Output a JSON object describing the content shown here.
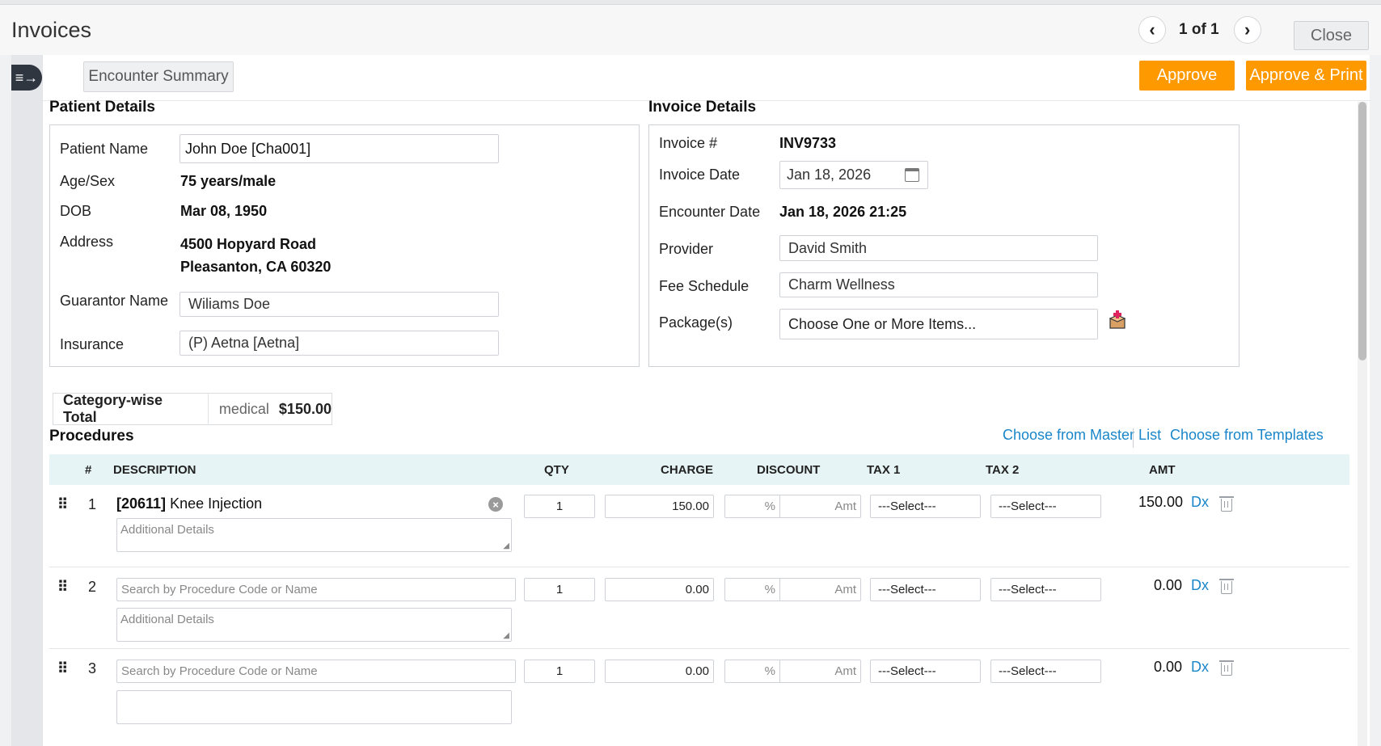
{
  "header": {
    "title": "Invoices",
    "pager_text": "1 of 1",
    "close_label": "Close",
    "prev_icon": "chevron-left-icon",
    "next_icon": "chevron-right-icon"
  },
  "toolbar": {
    "encounter_summary": "Encounter Summary",
    "approve": "Approve",
    "approve_print": "Approve & Print"
  },
  "patient": {
    "section_title": "Patient Details",
    "name_label": "Patient Name",
    "name_value": "John Doe [Cha001]",
    "age_label": "Age/Sex",
    "age_value": "75 years/male",
    "dob_label": "DOB",
    "dob_value": "Mar 08, 1950",
    "address_label": "Address",
    "address_line1": "4500 Hopyard Road",
    "address_line2": "Pleasanton, CA 60320",
    "guarantor_label": "Guarantor Name",
    "guarantor_value": "Wiliams Doe",
    "insurance_label": "Insurance",
    "insurance_value": "(P) Aetna [Aetna]"
  },
  "invoice": {
    "section_title": "Invoice Details",
    "number_label": "Invoice #",
    "number_value": "INV9733",
    "date_label": "Invoice Date",
    "date_value": "Jan 18, 2026",
    "encounter_label": "Encounter Date",
    "encounter_value": "Jan 18, 2026 21:25",
    "provider_label": "Provider",
    "provider_value": "David Smith",
    "fee_label": "Fee Schedule",
    "fee_value": "Charm Wellness",
    "package_label": "Package(s)",
    "package_placeholder": "Choose One or More Items..."
  },
  "category_total": {
    "title": "Category-wise Total",
    "category": "medical",
    "amount": "$150.00"
  },
  "procedures": {
    "section_title": "Procedures",
    "master_list_link": "Choose from Master List",
    "templates_link": "Choose from Templates",
    "columns": {
      "num": "#",
      "description": "DESCRIPTION",
      "qty": "QTY",
      "charge": "CHARGE",
      "discount": "DISCOUNT",
      "tax1": "TAX 1",
      "tax2": "TAX 2",
      "amt": "AMT"
    },
    "search_placeholder": "Search by Procedure Code or Name",
    "details_placeholder": "Additional Details",
    "pct_placeholder": "%",
    "amt_placeholder": "Amt",
    "select_placeholder": "---Select---",
    "dx_label": "Dx",
    "rows": [
      {
        "num": "1",
        "code": "[20611]",
        "name": "Knee Injection",
        "qty": "1",
        "charge": "150.00",
        "amt": "150.00"
      },
      {
        "num": "2",
        "qty": "1",
        "charge": "0.00",
        "amt": "0.00"
      },
      {
        "num": "3",
        "qty": "1",
        "charge": "0.00",
        "amt": "0.00"
      }
    ]
  },
  "colors": {
    "accent_orange": "#ff9900",
    "link_blue": "#1a86c9",
    "table_header_bg": "#e6f4f5"
  }
}
